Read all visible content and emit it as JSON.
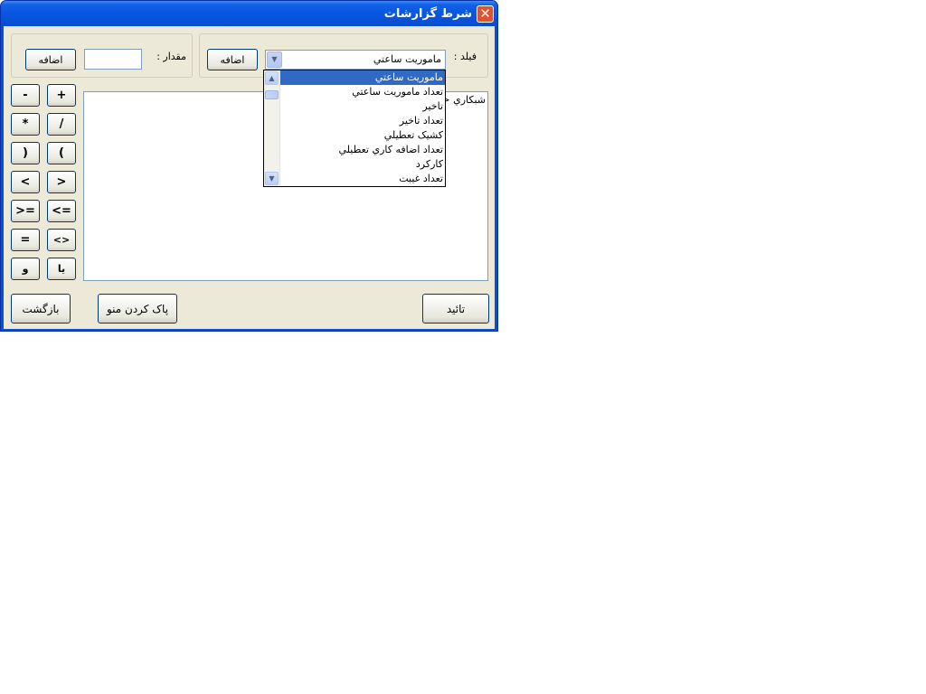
{
  "window": {
    "title": "شرط گزارشات",
    "close_icon": "close-icon"
  },
  "field_group": {
    "label": "فيلد :",
    "combo_value": "ماموريت ساعتي",
    "add_label": "اضافه",
    "dropdown_arrow_icon": "chevron-down-icon"
  },
  "value_group": {
    "label": "مقدار :",
    "input_value": "",
    "add_label": "اضافه"
  },
  "dropdown": {
    "items": [
      "ماموريت ساعتي",
      "تعداد ماموريت ساعتي",
      "تاخير",
      "تعداد تاخير",
      "کشيک تعطيلي",
      "تعداد اضافه کاري تعطيلي",
      "کارکرد",
      "تعداد غيبت"
    ],
    "selected_index": 0
  },
  "operators": [
    [
      "+",
      "-"
    ],
    [
      "/",
      "*"
    ],
    [
      "(",
      ")"
    ],
    [
      ">",
      "<"
    ],
    [
      "<=",
      ">="
    ],
    [
      "<>",
      "="
    ],
    [
      "يا",
      "و"
    ]
  ],
  "memo": {
    "text": "شبکاري <"
  },
  "footer": {
    "confirm_label": "تائيد",
    "clear_label": "پاک کردن منو",
    "back_label": "بازگشت"
  },
  "colors": {
    "titlebar": "#0a4fd0",
    "client_bg": "#ece9d8",
    "selection": "#316ac5"
  }
}
